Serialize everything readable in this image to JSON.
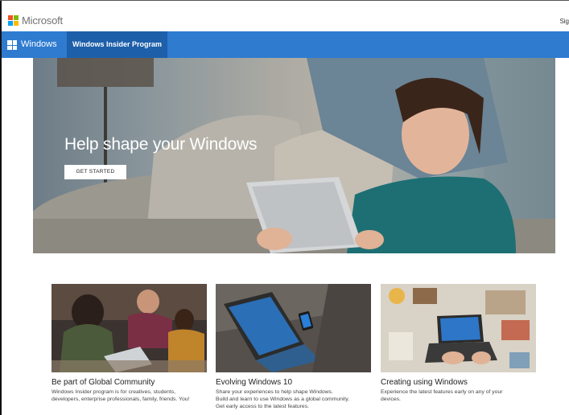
{
  "header": {
    "brand": "Microsoft",
    "signin": "Sig"
  },
  "nav": {
    "windows_label": "Windows",
    "insider_label": "Windows Insider Program"
  },
  "hero": {
    "title": "Help shape your Windows",
    "button_label": "GET STARTED"
  },
  "cards": [
    {
      "title": "Be part of Global Community",
      "lines": [
        "Windows Insider program is for creatives, students,",
        "developers, enterprise professionals, family, friends. You!"
      ]
    },
    {
      "title": "Evolving Windows 10",
      "lines": [
        "Share your experiences to help shape Windows.",
        "Build and learn to use Windows as a global community.",
        "Get early access to the latest features."
      ]
    },
    {
      "title": "Creating using Windows",
      "lines": [
        "Experience the latest features early on any of your",
        "devices."
      ]
    }
  ],
  "colors": {
    "nav_blue": "#2e7bd0",
    "nav_active": "#1d5fa9",
    "logo_red": "#f25022",
    "logo_green": "#7fba00",
    "logo_blue": "#00a4ef",
    "logo_yellow": "#ffb900"
  },
  "icons": [
    "microsoft-logo-icon",
    "windows-logo-icon"
  ]
}
